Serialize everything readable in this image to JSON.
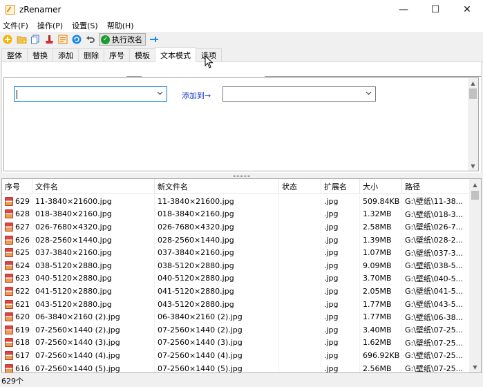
{
  "app": {
    "title": "zRenamer"
  },
  "window": {
    "minimize": "—",
    "maximize": "☐",
    "close": "✕"
  },
  "menu": [
    "文件(F)",
    "操作(P)",
    "设置(S)",
    "帮助(H)"
  ],
  "toolbar": {
    "execute_label": "执行改名",
    "check_glyph": "✓"
  },
  "tabs": [
    {
      "label": "整体",
      "active": false
    },
    {
      "label": "替换",
      "active": false
    },
    {
      "label": "添加",
      "active": false
    },
    {
      "label": "删除",
      "active": false
    },
    {
      "label": "序号",
      "active": false
    },
    {
      "label": "模板",
      "active": false
    },
    {
      "label": "文本模式",
      "active": true
    },
    {
      "label": "选项",
      "active": false
    }
  ],
  "panel": {
    "add_to_label": "添加到→",
    "combo_left_value": "",
    "combo_right_value": ""
  },
  "table": {
    "columns": [
      "序号",
      "文件名",
      "新文件名",
      "状态",
      "扩展名",
      "大小",
      "路径"
    ],
    "rows": [
      {
        "seq": "629",
        "name": "11-3840×21600.jpg",
        "new_name": "11-3840×21600.jpg",
        "status": "",
        "ext": ".jpg",
        "size": "509.84KB",
        "path": "G:\\壁纸\\11-38..."
      },
      {
        "seq": "628",
        "name": "018-3840×2160.jpg",
        "new_name": "018-3840×2160.jpg",
        "status": "",
        "ext": ".jpg",
        "size": "1.32MB",
        "path": "G:\\壁纸\\018-3..."
      },
      {
        "seq": "627",
        "name": "026-7680×4320.jpg",
        "new_name": "026-7680×4320.jpg",
        "status": "",
        "ext": ".jpg",
        "size": "2.58MB",
        "path": "G:\\壁纸\\026-7..."
      },
      {
        "seq": "626",
        "name": "028-2560×1440.jpg",
        "new_name": "028-2560×1440.jpg",
        "status": "",
        "ext": ".jpg",
        "size": "1.39MB",
        "path": "G:\\壁纸\\028-2..."
      },
      {
        "seq": "625",
        "name": "037-3840×2160.jpg",
        "new_name": "037-3840×2160.jpg",
        "status": "",
        "ext": ".jpg",
        "size": "1.07MB",
        "path": "G:\\壁纸\\037-3..."
      },
      {
        "seq": "624",
        "name": "038-5120×2880.jpg",
        "new_name": "038-5120×2880.jpg",
        "status": "",
        "ext": ".jpg",
        "size": "9.09MB",
        "path": "G:\\壁纸\\038-5..."
      },
      {
        "seq": "623",
        "name": "040-5120×2880.jpg",
        "new_name": "040-5120×2880.jpg",
        "status": "",
        "ext": ".jpg",
        "size": "3.70MB",
        "path": "G:\\壁纸\\040-5..."
      },
      {
        "seq": "622",
        "name": "041-5120×2880.jpg",
        "new_name": "041-5120×2880.jpg",
        "status": "",
        "ext": ".jpg",
        "size": "2.05MB",
        "path": "G:\\壁纸\\041-5..."
      },
      {
        "seq": "621",
        "name": "043-5120×2880.jpg",
        "new_name": "043-5120×2880.jpg",
        "status": "",
        "ext": ".jpg",
        "size": "1.77MB",
        "path": "G:\\壁纸\\043-5..."
      },
      {
        "seq": "620",
        "name": "06-3840×2160 (2).jpg",
        "new_name": "06-3840×2160 (2).jpg",
        "status": "",
        "ext": ".jpg",
        "size": "1.77MB",
        "path": "G:\\壁纸\\06-38..."
      },
      {
        "seq": "619",
        "name": "07-2560×1440 (2).jpg",
        "new_name": "07-2560×1440 (2).jpg",
        "status": "",
        "ext": ".jpg",
        "size": "3.40MB",
        "path": "G:\\壁纸\\07-25..."
      },
      {
        "seq": "618",
        "name": "07-2560×1440 (3).jpg",
        "new_name": "07-2560×1440 (3).jpg",
        "status": "",
        "ext": ".jpg",
        "size": "1.62MB",
        "path": "G:\\壁纸\\07-25..."
      },
      {
        "seq": "617",
        "name": "07-2560×1440 (4).jpg",
        "new_name": "07-2560×1440 (4).jpg",
        "status": "",
        "ext": ".jpg",
        "size": "696.92KB",
        "path": "G:\\壁纸\\07-25..."
      },
      {
        "seq": "616",
        "name": "07-2560×1440 (5).jpg",
        "new_name": "07-2560×1440 (5).jpg",
        "status": "",
        "ext": ".jpg",
        "size": "2.56MB",
        "path": "G:\\壁纸\\07-25..."
      }
    ]
  },
  "status_bar": {
    "count": "629个"
  },
  "colors": {
    "accent": "#0078d7",
    "link": "#1f3ec9",
    "execute_green": "#1d9a2c"
  }
}
